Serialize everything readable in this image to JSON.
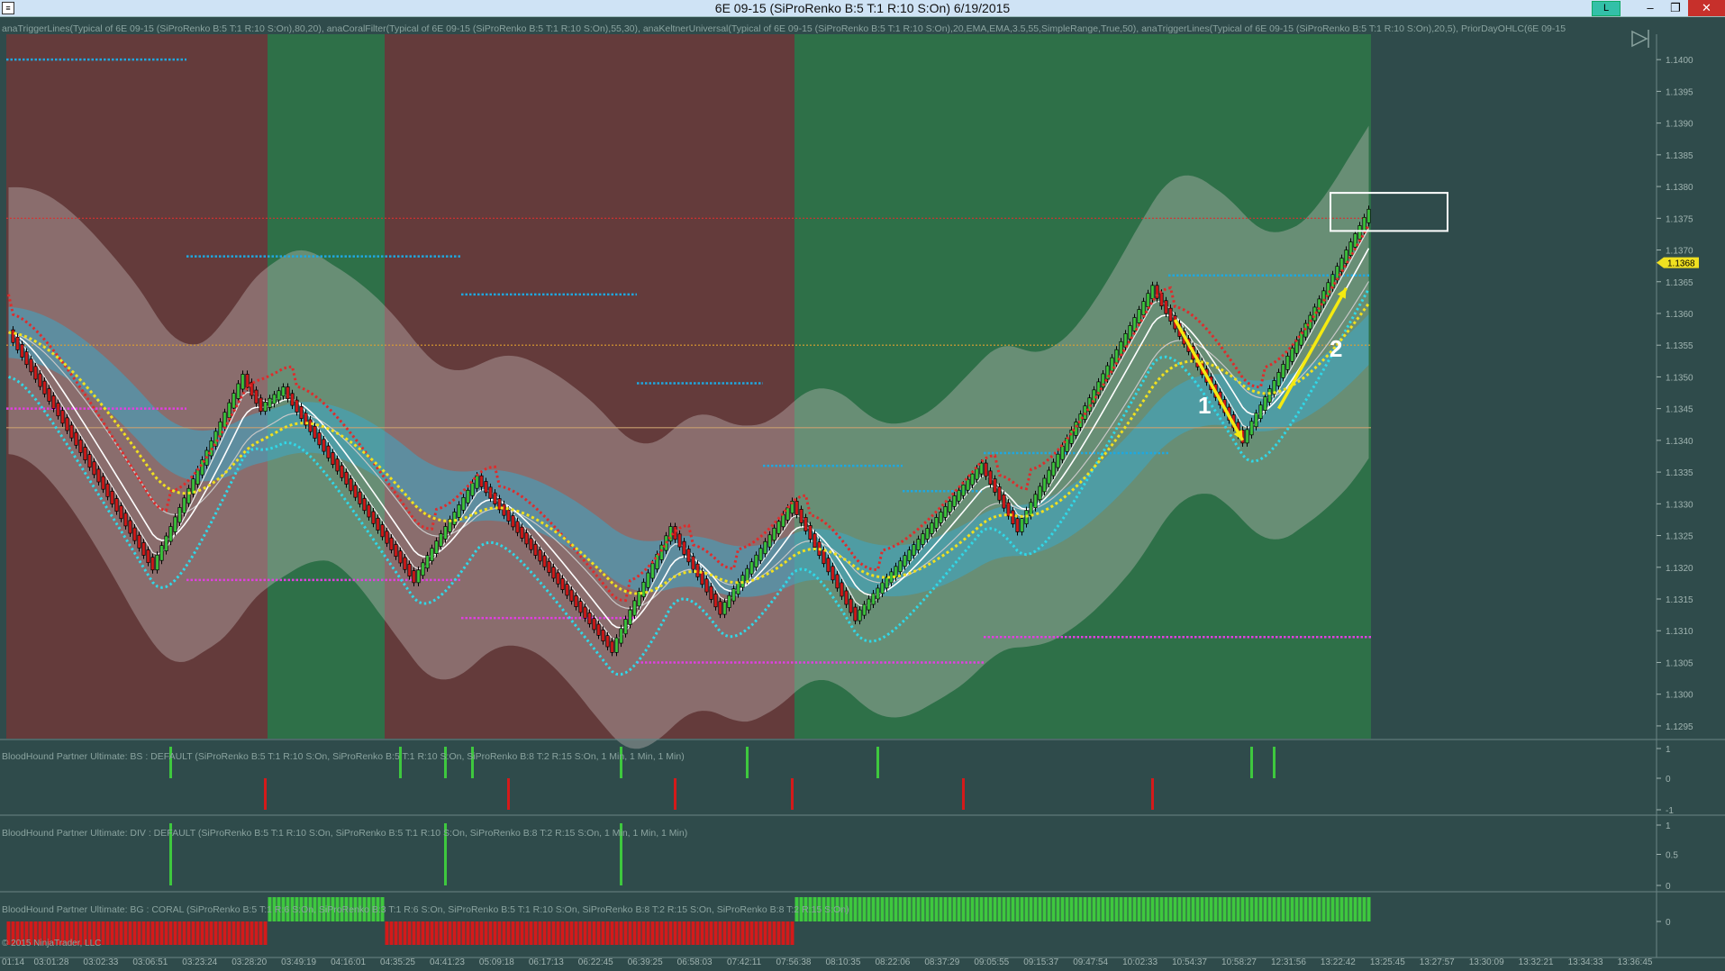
{
  "window": {
    "title": "6E 09-15 (SiProRenko B:5 T:1 R:10 S:On)  6/19/2015",
    "icon": "ninjatrader-chart-icon",
    "badge": "L",
    "minimize_glyph": "–",
    "maximize_glyph": "❐",
    "close_glyph": "✕"
  },
  "main_panel": {
    "indicator_legend": "anaTriggerLines(Typical of 6E 09-15 (SiProRenko B:5 T:1 R:10 S:On),80,20), anaCoralFilter(Typical of 6E 09-15 (SiProRenko B:5 T:1 R:10 S:On),55,30), anaKeltnerUniversal(Typical of 6E 09-15 (SiProRenko B:5 T:1 R:10 S:On),20,EMA,EMA,3.5,55,SimpleRange,True,50), anaTriggerLines(Typical of 6E 09-15 (SiProRenko B:5 T:1 R:10 S:On),20,5), PriorDayOHLC(6E 09-15",
    "last_price_label": "1.1368",
    "annotations": [
      "1",
      "2"
    ],
    "nav_icon": "scroll-to-end-icon"
  },
  "sub_panels": [
    {
      "legend": "BloodHound Partner Ultimate: BS : DEFAULT (SiProRenko B:5 T:1 R:10 S:On, SiProRenko B:5 T:1 R:10 S:On, SiProRenko B:8 T:2 R:15 S:On, 1 Min, 1 Min, 1 Min)",
      "ticks": [
        "1",
        "0",
        "-1"
      ]
    },
    {
      "legend": "BloodHound Partner Ultimate: DIV : DEFAULT (SiProRenko B:5 T:1 R:10 S:On, SiProRenko B:5 T:1 R:10 S:On, SiProRenko B:8 T:2 R:15 S:On, 1 Min, 1 Min, 1 Min)",
      "ticks": [
        "1",
        "0.5",
        "0"
      ]
    },
    {
      "legend": "BloodHound Partner Ultimate: BG : CORAL (SiProRenko B:5 T:1 R:6 S:On, SiProRenko B:3 T:1 R:6 S:On, SiProRenko B:5 T:1 R:10 S:On, SiProRenko B:8 T:2 R:15 S:On, SiProRenko B:8 T:2 R:15 S:On)",
      "ticks": [
        "0"
      ]
    }
  ],
  "copyright": "© 2015 NinjaTrader, LLC",
  "colors": {
    "background": "#2f4b4b",
    "bull_zone": "#2e7048",
    "bear_zone": "#643b3b",
    "up_bar": "#3ec83e",
    "down_bar": "#d41a1a",
    "trigger_red": "#e02b2b",
    "trigger_cyan": "#30d8e8",
    "trigger_yellow": "#f0e020",
    "pivot_blue": "#1fa8e0",
    "pivot_magenta": "#e040e0",
    "arrow_yellow": "#f5ea10"
  },
  "chart_data": {
    "type": "candlestick",
    "instrument": "6E 09-15",
    "bar_type": "SiProRenko B:5 T:1 R:10 S:On",
    "date": "6/19/2015",
    "y_ticks": [
      "1.1400",
      "1.1395",
      "1.1390",
      "1.1385",
      "1.1380",
      "1.1375",
      "1.1370",
      "1.1365",
      "1.1360",
      "1.1355",
      "1.1350",
      "1.1345",
      "1.1340",
      "1.1335",
      "1.1330",
      "1.1325",
      "1.1320",
      "1.1315",
      "1.1310",
      "1.1305",
      "1.1300",
      "1.1295"
    ],
    "ylim": [
      1.1293,
      1.1404
    ],
    "x_ticks": [
      "01:14",
      "03:01:28",
      "03:02:33",
      "03:06:51",
      "03:23:24",
      "03:28:20",
      "03:49:19",
      "04:16:01",
      "04:35:25",
      "04:41:23",
      "05:09:18",
      "06:17:13",
      "06:22:45",
      "06:39:25",
      "06:58:03",
      "07:42:11",
      "07:56:38",
      "08:10:35",
      "08:22:06",
      "08:37:29",
      "09:05:55",
      "09:15:37",
      "09:47:54",
      "10:02:33",
      "10:54:37",
      "10:58:27",
      "12:31:56",
      "13:22:42",
      "13:25:45",
      "13:27:57",
      "13:30:09",
      "13:32:21",
      "13:34:33",
      "13:36:45"
    ],
    "price_swings": [
      {
        "bar": 0,
        "price": 1.1357
      },
      {
        "bar": 32,
        "price": 1.132
      },
      {
        "bar": 52,
        "price": 1.135
      },
      {
        "bar": 56,
        "price": 1.1345
      },
      {
        "bar": 61,
        "price": 1.1348
      },
      {
        "bar": 90,
        "price": 1.1318
      },
      {
        "bar": 104,
        "price": 1.1334
      },
      {
        "bar": 134,
        "price": 1.1307
      },
      {
        "bar": 147,
        "price": 1.1326
      },
      {
        "bar": 158,
        "price": 1.1313
      },
      {
        "bar": 174,
        "price": 1.133
      },
      {
        "bar": 188,
        "price": 1.1312
      },
      {
        "bar": 216,
        "price": 1.1336
      },
      {
        "bar": 224,
        "price": 1.1326
      },
      {
        "bar": 254,
        "price": 1.1364
      },
      {
        "bar": 274,
        "price": 1.134
      },
      {
        "bar": 302,
        "price": 1.1376
      }
    ],
    "last_price": 1.1368,
    "zones": [
      {
        "from_bar": 0,
        "to_bar": 58,
        "trend": "bear"
      },
      {
        "from_bar": 58,
        "to_bar": 84,
        "trend": "bull"
      },
      {
        "from_bar": 84,
        "to_bar": 175,
        "trend": "bear"
      },
      {
        "from_bar": 175,
        "to_bar": 303,
        "trend": "bull"
      }
    ],
    "prior_day_lines": [
      {
        "price": 1.1375,
        "color": "#d83030",
        "style": "dotted"
      },
      {
        "price": 1.1355,
        "color": "#e0a030",
        "style": "dotted"
      },
      {
        "price": 1.1342,
        "color": "#c8a070",
        "style": "solid"
      }
    ],
    "pivot_segments": [
      {
        "from_bar": 0,
        "to_bar": 40,
        "price": 1.14,
        "color": "#1fa8e0"
      },
      {
        "from_bar": 40,
        "to_bar": 101,
        "price": 1.1369,
        "color": "#1fa8e0"
      },
      {
        "from_bar": 101,
        "to_bar": 140,
        "price": 1.1363,
        "color": "#1fa8e0"
      },
      {
        "from_bar": 140,
        "to_bar": 168,
        "price": 1.1349,
        "color": "#1fa8e0"
      },
      {
        "from_bar": 168,
        "to_bar": 199,
        "price": 1.1336,
        "color": "#1fa8e0"
      },
      {
        "from_bar": 199,
        "to_bar": 217,
        "price": 1.1332,
        "color": "#1fa8e0"
      },
      {
        "from_bar": 217,
        "to_bar": 258,
        "price": 1.1338,
        "color": "#1fa8e0"
      },
      {
        "from_bar": 258,
        "to_bar": 303,
        "price": 1.1366,
        "color": "#1fa8e0"
      },
      {
        "from_bar": 0,
        "to_bar": 40,
        "price": 1.1345,
        "color": "#e040e0"
      },
      {
        "from_bar": 40,
        "to_bar": 101,
        "price": 1.1318,
        "color": "#e040e0"
      },
      {
        "from_bar": 101,
        "to_bar": 140,
        "price": 1.1312,
        "color": "#e040e0"
      },
      {
        "from_bar": 140,
        "to_bar": 217,
        "price": 1.1305,
        "color": "#e040e0"
      },
      {
        "from_bar": 217,
        "to_bar": 303,
        "price": 1.1309,
        "color": "#e040e0"
      }
    ],
    "arrows": [
      {
        "label": "1",
        "from": {
          "bar": 259,
          "price": 1.1359
        },
        "to": {
          "bar": 274,
          "price": 1.134
        }
      },
      {
        "label": "2",
        "from": {
          "bar": 282,
          "price": 1.1345
        },
        "to": {
          "bar": 297,
          "price": 1.1364
        }
      }
    ],
    "highlight_box": {
      "from_bar": 294,
      "to_bar": 320,
      "price_top": 1.1379,
      "price_bottom": 1.1373
    },
    "bs_signals": [
      {
        "bar": 36,
        "value": 1
      },
      {
        "bar": 57,
        "value": -1
      },
      {
        "bar": 87,
        "value": 1
      },
      {
        "bar": 97,
        "value": 1
      },
      {
        "bar": 103,
        "value": 1
      },
      {
        "bar": 111,
        "value": -1
      },
      {
        "bar": 136,
        "value": 1
      },
      {
        "bar": 148,
        "value": -1
      },
      {
        "bar": 164,
        "value": 1
      },
      {
        "bar": 174,
        "value": -1
      },
      {
        "bar": 193,
        "value": 1
      },
      {
        "bar": 212,
        "value": -1
      },
      {
        "bar": 254,
        "value": -1
      },
      {
        "bar": 276,
        "value": 1
      },
      {
        "bar": 281,
        "value": 1
      }
    ],
    "div_signals": [
      {
        "bar": 36,
        "value": 1
      },
      {
        "bar": 97,
        "value": 1
      },
      {
        "bar": 136,
        "value": 1
      }
    ],
    "bg_state": [
      {
        "from_bar": 0,
        "to_bar": 58,
        "value": "bear"
      },
      {
        "from_bar": 58,
        "to_bar": 84,
        "value": "bull"
      },
      {
        "from_bar": 84,
        "to_bar": 175,
        "value": "bear"
      },
      {
        "from_bar": 175,
        "to_bar": 303,
        "value": "bull"
      }
    ]
  }
}
